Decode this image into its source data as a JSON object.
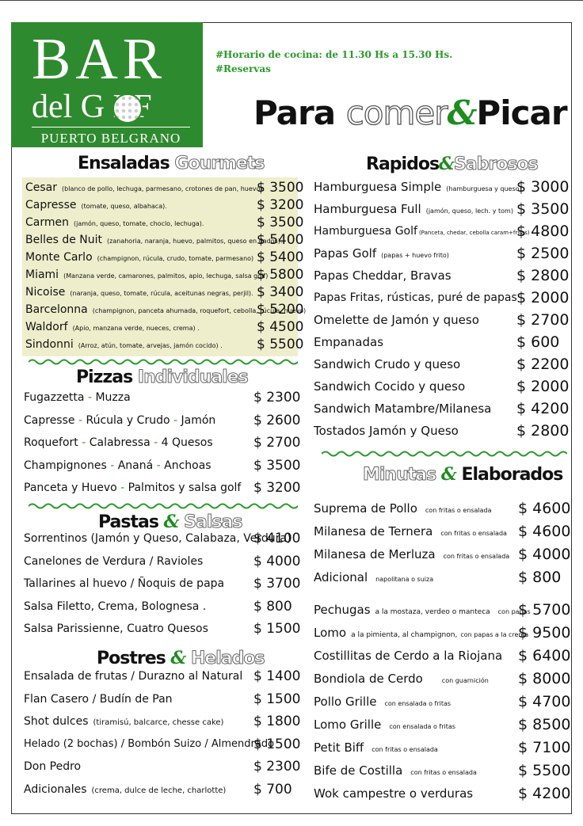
{
  "logo": {
    "bar": "BAR",
    "del_golf": "del G  LF",
    "location": "PUERTO BELGRANO"
  },
  "info": {
    "hours": "#Horario de cocina: de 11.30 Hs a 15.30 Hs.",
    "reservas": "#Reservas"
  },
  "title": {
    "part1": "Para",
    "part2": "comer",
    "amp": "&",
    "part3": "Picar"
  },
  "ensaladas": {
    "title_bold": "Ensaladas",
    "title_outline": "Gourmets",
    "items": [
      {
        "name": "Cesar",
        "desc": "(blanco de pollo, lechuga, parmesano, crotones de pan, huevo).",
        "price": "$ 3500"
      },
      {
        "name": "Capresse",
        "desc": "(tomate, queso, albahaca).",
        "price": "$ 3200"
      },
      {
        "name": "Carmen",
        "desc": "(jamón, queso, tomate, choclo, lechuga).",
        "price": "$ 3500"
      },
      {
        "name": "Belles de Nuit",
        "desc": "(zanahoria, naranja, huevo, palmitos, queso en dados).",
        "price": "$ 5400"
      },
      {
        "name": "Monte Carlo",
        "desc": "(champignon, rúcula, crudo, tomate, parmesano)",
        "price": "$ 5400"
      },
      {
        "name": "Miami",
        "desc": "(Manzana verde, camarones, palmitos, apio, lechuga, salsa golf) .",
        "price": "$ 5800"
      },
      {
        "name": "Nicoise",
        "desc": "(naranja, queso, tomate, rúcula, aceitunas negras, perjil).",
        "price": "$ 3400"
      },
      {
        "name": "Barcelonna",
        "desc": "(champignon, panceta ahumada, roquefort, cebolla, rúcula, huevo)",
        "price": "$ 5200"
      },
      {
        "name": "Waldorf",
        "desc": "(Apio, manzana verde, nueces, crema) .",
        "price": "$ 4500"
      },
      {
        "name": "Sindonni",
        "desc": "(Arroz, atún, tomate, arvejas, jamón cocido) .",
        "price": "$ 5500"
      }
    ]
  },
  "pizzas": {
    "title_bold": "Pizzas",
    "title_outline": "Individuales",
    "items": [
      {
        "a": "Fugazzetta",
        "b": "Muzza",
        "c": "",
        "price": "$ 2300"
      },
      {
        "a": "Capresse",
        "b": "Rúcula y Crudo",
        "c": "Jamón",
        "price": "$ 2600"
      },
      {
        "a": "Roquefort",
        "b": "Calabressa",
        "c": "4 Quesos",
        "price": "$ 2700"
      },
      {
        "a": "Champignones",
        "b": "Ananá",
        "c": "Anchoas",
        "price": "$ 3500"
      },
      {
        "a": "Panceta y Huevo",
        "b": "Palmitos y salsa golf",
        "c": "",
        "price": "$ 3200"
      }
    ]
  },
  "pastas": {
    "title_bold": "Pastas",
    "amp": "&",
    "title_outline": "Salsas",
    "items": [
      {
        "name": "Sorrentinos (Jamón y Queso, Calabaza, Verdura)",
        "price": "$ 4100"
      },
      {
        "name": "Canelones de Verdura / Ravioles",
        "price": "$ 4000"
      },
      {
        "name": "Tallarines al huevo  /  Ñoquis de papa",
        "price": "$ 3700"
      },
      {
        "name": "Salsa Filetto, Crema, Bolognesa .",
        "price": "$ 800"
      },
      {
        "name": "Salsa Parissienne, Cuatro Quesos",
        "price": "$ 1500"
      }
    ]
  },
  "postres": {
    "title_bold": "Postres",
    "amp": "&",
    "title_outline": "Helados",
    "items": [
      {
        "name": "Ensalada de frutas / Durazno al Natural",
        "desc": "",
        "price": "$ 1400"
      },
      {
        "name": "Flan Casero / Budín de Pan",
        "desc": "",
        "price": "$ 1500"
      },
      {
        "name": "Shot dulces",
        "desc": "(tiramisú, balcarce, chesse cake)",
        "price": "$ 1800"
      },
      {
        "name": "Helado (2 bochas) / Bombón Suizo / Almendrado",
        "desc": "",
        "price": "$ 1500"
      },
      {
        "name": "Don Pedro",
        "desc": "",
        "price": "$ 2300"
      },
      {
        "name": "Adicionales",
        "desc": "(crema, dulce de leche, charlotte)",
        "price": "$ 700"
      }
    ]
  },
  "rapidos": {
    "title_bold": "Rapidos",
    "amp": "&",
    "title_outline": "Sabrosos",
    "items": [
      {
        "name": "Hamburguesa Simple",
        "desc": "(hamburguesa y queso)",
        "price": "$ 3000"
      },
      {
        "name": "Hamburguesa Full",
        "desc": "(jamón, queso, lech. y tom)",
        "price": "$ 3500"
      },
      {
        "name": "Hamburguesa Golf",
        "desc": "(Panceta, chedar, cebolla caram+fritas)",
        "price": "$ 4800"
      },
      {
        "name": "Papas Golf",
        "desc": "(papas + huevo frito)",
        "price": "$ 2500"
      },
      {
        "name": "Papas Cheddar, Bravas",
        "desc": "",
        "price": "$ 2800"
      },
      {
        "name": "Papas Fritas, rústicas, puré de papas",
        "desc": "",
        "price": "$ 2000"
      },
      {
        "name": "Omelette de Jamón y queso",
        "desc": "",
        "price": "$ 2700"
      },
      {
        "name": "Empanadas",
        "desc": "",
        "price": "$ 600"
      },
      {
        "name": "Sandwich Crudo y queso",
        "desc": "",
        "price": "$ 2200"
      },
      {
        "name": "Sandwich Cocido y queso",
        "desc": "",
        "price": "$ 2000"
      },
      {
        "name": "Sandwich Matambre/Milanesa",
        "desc": "",
        "price": "$ 4200"
      },
      {
        "name": "Tostados Jamón y Queso",
        "desc": "",
        "price": "$ 2800"
      }
    ]
  },
  "minutas": {
    "title_outline": "Minutas",
    "amp": "&",
    "title_bold": "Elaborados",
    "group1": [
      {
        "name": "Suprema de Pollo",
        "desc": "con fritas o ensalada",
        "price": "$ 4600"
      },
      {
        "name": "Milanesa de Ternera",
        "desc": "con fritas o ensalada",
        "price": "$ 4600"
      },
      {
        "name": "Milanesa de Merluza",
        "desc": "con fritas o ensalada",
        "price": "$ 4000"
      },
      {
        "name": "Adicional",
        "desc": "napolitana o suiza",
        "price": "$ 800"
      }
    ],
    "group2": [
      {
        "name": "Pechugas",
        "desc": "a la mostaza, verdeo o manteca",
        "note": "con papas",
        "price": "$ 5700"
      },
      {
        "name": "Lomo",
        "desc": "a la pimienta, al champignon,",
        "note": "con papas a la crema",
        "price": "$ 9500"
      },
      {
        "name": "Costillitas de Cerdo a la Riojana",
        "desc": "",
        "note": "",
        "price": "$ 6400"
      },
      {
        "name": "Bondiola de Cerdo",
        "desc": "",
        "note": "con guarnición",
        "price": "$ 8000"
      },
      {
        "name": "Pollo Grille",
        "desc": "",
        "note": "con ensalada o fritas",
        "price": "$ 4700"
      },
      {
        "name": "Lomo Grille",
        "desc": "",
        "note": "con ensalada o fritas",
        "price": "$ 8500"
      },
      {
        "name": "Petit Biff",
        "desc": "",
        "note": "con fritas o ensalada",
        "price": "$ 7100"
      },
      {
        "name": "Bife de Costilla",
        "desc": "",
        "note": "con fritas o ensalada",
        "price": "$ 5500"
      },
      {
        "name": "Wok campestre o verduras",
        "desc": "",
        "note": "",
        "price": "$ 4200"
      }
    ]
  },
  "colors": {
    "green": "#2e8a2e",
    "salad_bg": "#eeeecc"
  }
}
